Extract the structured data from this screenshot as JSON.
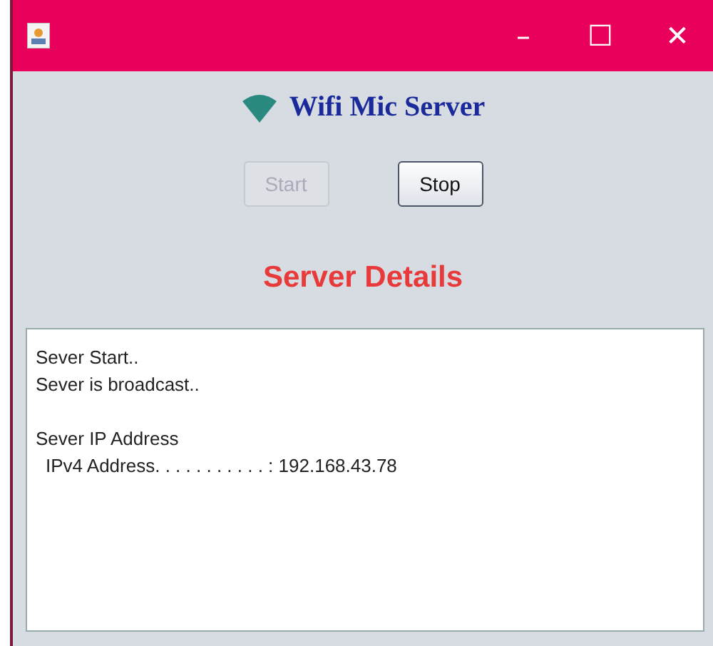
{
  "window": {
    "title_controls": [
      "–",
      "☐",
      "✕"
    ]
  },
  "app_title": "Wifi Mic Server",
  "buttons": [
    {
      "label": "Start",
      "disabled": true
    },
    {
      "label": "Stop",
      "disabled": false
    }
  ],
  "section_title": "Server Details",
  "log": [
    {
      "lines": [
        {
          "text": "Sever Start..",
          "indented": false
        },
        {
          "text": "Sever is broadcast..",
          "indented": false
        }
      ]
    },
    {
      "lines": [
        {
          "text": "Sever IP Address",
          "indented": false
        },
        {
          "text": "IPv4 Address. . . . . . . . . . . : 192.168.43.78",
          "indented": true
        }
      ]
    }
  ]
}
